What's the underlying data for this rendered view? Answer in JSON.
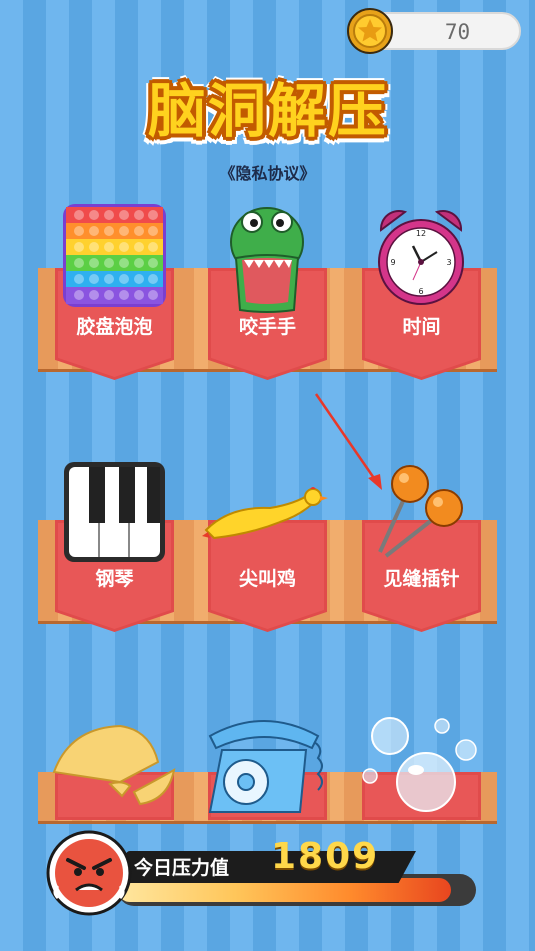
{
  "header": {
    "coin_count": "70"
  },
  "title": {
    "text": "脑洞解压",
    "privacy_link": "《隐私协议》"
  },
  "games": [
    {
      "label": "胶盘泡泡",
      "icon": "pop-it-icon"
    },
    {
      "label": "咬手手",
      "icon": "crocodile-icon"
    },
    {
      "label": "时间",
      "icon": "alarm-clock-icon"
    },
    {
      "label": "钢琴",
      "icon": "piano-icon"
    },
    {
      "label": "尖叫鸡",
      "icon": "rubber-chicken-icon"
    },
    {
      "label": "见缝插针",
      "icon": "pins-icon"
    },
    {
      "label": "",
      "icon": "tortilla-icon"
    },
    {
      "label": "",
      "icon": "telephone-icon"
    },
    {
      "label": "",
      "icon": "bubbles-icon"
    }
  ],
  "stress": {
    "label": "今日压力值",
    "value": "1809",
    "fill_fraction": 0.93
  },
  "colors": {
    "ribbon": "#e85757",
    "shelf": "#f1ad6d",
    "background": "#6fb6ee",
    "title": "#ffd21e"
  }
}
